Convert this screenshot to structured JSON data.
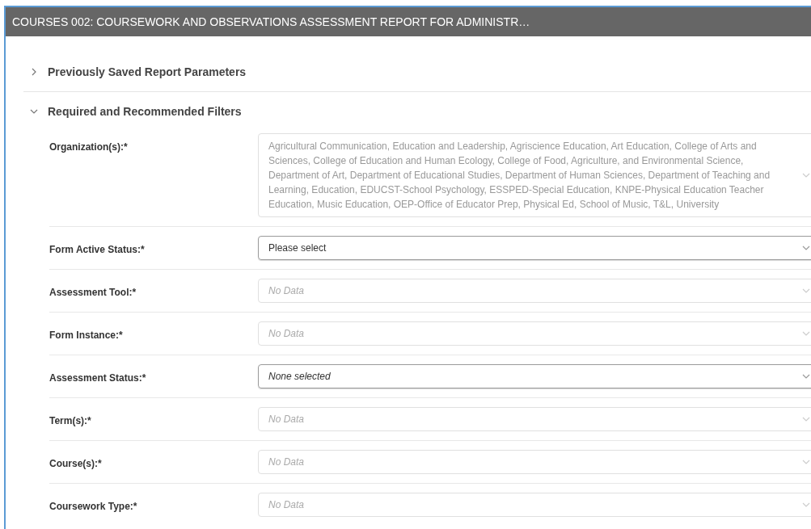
{
  "window": {
    "title": "COURSES 002: COURSEWORK AND OBSERVATIONS ASSESSMENT REPORT FOR ADMINISTR…"
  },
  "sections": [
    {
      "title": "Previously Saved Report Parameters",
      "expanded": false
    },
    {
      "title": "Required and Recommended Filters",
      "expanded": true
    }
  ],
  "filters": [
    {
      "label": "Organization(s):*",
      "kind": "multiselect",
      "disabled": true,
      "value": "Agricultural Communication, Education and Leadership, Agriscience Education, Art Education, College of Arts and Sciences, College of Education and Human Ecology, College of Food, Agriculture, and Environmental Science, Department of Art, Department of Educational Studies, Department of Human Sciences, Department of Teaching and Learning, Education, EDUCST-School Psychology, ESSPED-Special Education, KNPE-Physical Education Teacher Education, Music Education, OEP-Office of Educator Prep, Physical Ed, School of Music, T&L, University"
    },
    {
      "label": "Form Active Status:*",
      "kind": "select",
      "disabled": false,
      "value": "Please select"
    },
    {
      "label": "Assessment Tool:*",
      "kind": "select",
      "disabled": true,
      "placeholder": "No Data"
    },
    {
      "label": "Form Instance:*",
      "kind": "select",
      "disabled": true,
      "placeholder": "No Data"
    },
    {
      "label": "Assessment Status:*",
      "kind": "multiselect",
      "disabled": false,
      "value": "None selected"
    },
    {
      "label": "Term(s):*",
      "kind": "select",
      "disabled": true,
      "placeholder": "No Data"
    },
    {
      "label": "Course(s):*",
      "kind": "select",
      "disabled": true,
      "placeholder": "No Data"
    },
    {
      "label": "Coursework Type:*",
      "kind": "select",
      "disabled": true,
      "placeholder": "No Data"
    }
  ]
}
